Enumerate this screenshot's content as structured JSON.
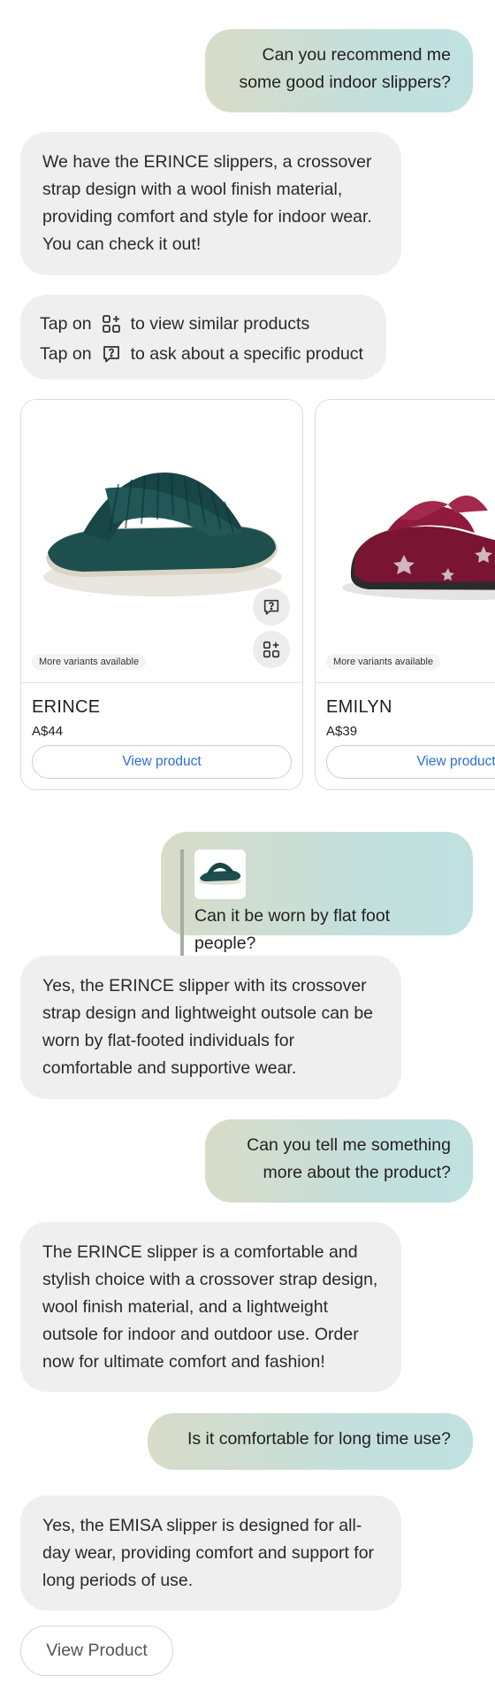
{
  "messages": {
    "m1_user": "Can you recommend me some good indoor slippers?",
    "m2_bot": "We have the ERINCE slippers, a crossover strap design with a wool finish material, providing comfort and style for indoor wear. You can check it out!",
    "hint": {
      "line1_prefix": "Tap on",
      "line1_suffix": "to view similar products",
      "line2_prefix": "Tap on",
      "line2_suffix": "to ask about a specific product",
      "icon1": "similar-products-icon",
      "icon2": "ask-question-icon"
    },
    "m3_user_quote": "Can it be worn by flat foot people?",
    "m4_bot": "Yes, the ERINCE slipper with its crossover strap design and lightweight outsole can be worn by flat-footed individuals for comfortable and supportive wear.",
    "m5_user": "Can you tell me something more about the product?",
    "m6_bot": "The ERINCE slipper is a comfortable and stylish choice with a crossover strap design, wool finish material, and a lightweight outsole for indoor and outdoor use. Order now for ultimate comfort and fashion!",
    "m7_user": "Is it comfortable for long time use?",
    "m8_bot": "Yes, the EMISA slipper is designed for all-day wear, providing comfort and support for long periods of use.",
    "view_product_button": "View Product"
  },
  "products": [
    {
      "name": "ERINCE",
      "price": "A$44",
      "badge": "More variants available",
      "button": "View product",
      "image": "green-crossover-slipper"
    },
    {
      "name": "EMILYN",
      "price": "A$39",
      "badge": "More variants available",
      "button": "View product",
      "image": "burgundy-velvet-star-slipper"
    }
  ],
  "colors": {
    "user_bubble_start": "#d8dcc8",
    "user_bubble_end": "#bfe2e1",
    "bot_bubble": "#efefef",
    "link_blue": "#2a6fd6"
  }
}
